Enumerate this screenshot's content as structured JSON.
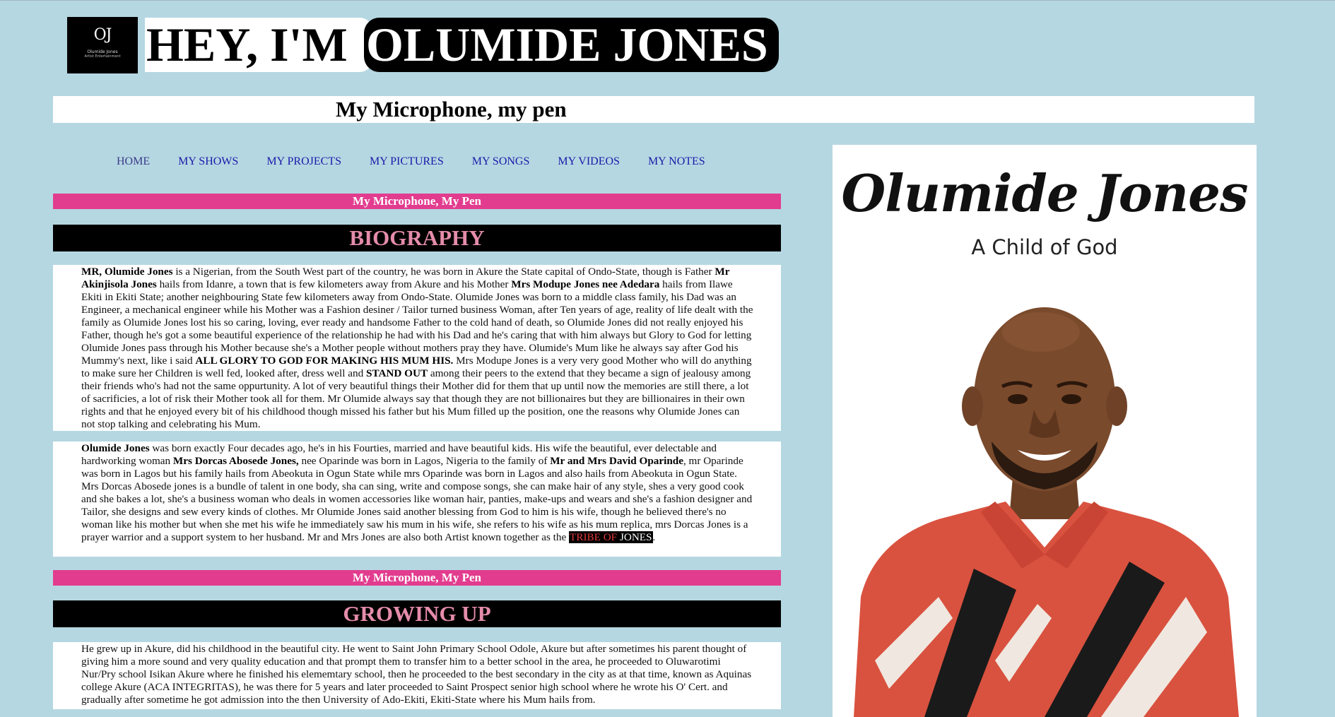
{
  "header": {
    "logo_mono": "OJ",
    "logo_name": "Olumide Jones",
    "logo_role": "Artist Entertainment",
    "hey_text": "HEY, I'M",
    "name_text": "OLUMIDE JONES",
    "tagline": "My Microphone, my pen"
  },
  "nav": {
    "items": [
      "HOME",
      "MY SHOWS",
      "MY PROJECTS",
      "MY PICTURES",
      "MY SONGS",
      "MY VIDEOS",
      "MY NOTES"
    ]
  },
  "sections": {
    "banner_1": "My Microphone, My Pen",
    "biography_title": "BIOGRAPHY",
    "banner_2": "My Microphone, My Pen",
    "growing_title": "GROWING UP"
  },
  "bio_p1": {
    "b1": "MR, Olumide Jones",
    "t1": " is a Nigerian, from the South West part of the country, he was born in Akure the State capital of Ondo-State, though is Father ",
    "b2": "Mr Akinjisola Jones",
    "t2": " hails from Idanre, a town that is few kilometers away from Akure and his Mother ",
    "b3": "Mrs Modupe Jones nee Adedara",
    "t3": " hails from Ilawe Ekiti in Ekiti State; another neighbouring State few kilometers away from Ondo-State. Olumide Jones was born to a middle class family, his Dad was an Engineer, a mechanical engineer while his Mother was a Fashion desiner / Tailor turned business Woman, after Ten years of age, reality of life dealt with the family as Olumide Jones lost his so caring, loving, ever ready and handsome Father to the cold hand of death, so Olumide Jones did not really enjoyed his Father, though he's got a some beautiful experience of the relationship he had with his Dad and he's caring that with him always but Glory to God for letting Olumide Jones pass through his Mother because she's a Mother people without mothers pray they have. Olumide's Mum like he always say after God his Mummy's next, like i said ",
    "b4": "ALL GLORY TO GOD FOR MAKING HIS MUM HIS.",
    "t4": " Mrs Modupe Jones is a very very good Mother who will do anything to make sure her Children is well fed, looked after, dress well and ",
    "b5": "STAND OUT",
    "t5": " among their peers to the extend that they became a sign of jealousy among their friends who's had not the same oppurtunity. A lot of very beautiful things their Mother did for them that up until now the memories are still there, a lot of sacrificies, a lot of risk their Mother took all for them. Mr Olumide always say that though they are not billionaires but they are billionaires in their own rights and that he enjoyed every bit of his childhood though missed his father but his Mum filled up the position, one the reasons why Olumide Jones can not stop talking and celebrating his Mum."
  },
  "bio_p2": {
    "b1": "Olumide Jones",
    "t1": " was born exactly Four decades ago, he's in his Fourties, married and have beautiful kids. His wife the beautiful, ever delectable and hardworking woman ",
    "b2": "Mrs Dorcas Abosede Jones,",
    "t2": " nee Oparinde was born in Lagos, Nigeria to the family of ",
    "b3": "Mr and Mrs David Oparinde",
    "t3": ", mr Oparinde was born in Lagos but his family hails from Abeokuta in Ogun State while mrs Oparinde was born in Lagos and also hails from Abeokuta in Ogun State. Mrs Dorcas Abosede jones is a bundle of talent in one body, sha can sing, write and compose songs, she can make hair of any style, shes a very good cook and she bakes a lot, she's a business woman who deals in women accessories like woman hair, panties, make-ups and wears and she's a fashion designer and Tailor, she designs and sew every kinds of clothes. Mr Olumide Jones said another blessing from God to him is his wife, though he believed there's no woman like his mother but when she met his wife he immediately saw his mum in his wife, she refers to his wife as his mum replica, mrs Dorcas Jones is a prayer warrior and a support system to her husband. Mr and Mrs Jones are also both Artist known together as the ",
    "tribe_red": "TRIBE OF",
    "tribe_white": " JONES",
    "t4": "."
  },
  "growing_p1": "He grew up in Akure, did his childhood in the beautiful city. He went to Saint John Primary School Odole, Akure but after sometimes his parent thought of giving him a more sound and very quality education and that prompt them to transfer him to a better school in the area, he proceeded to Oluwarotimi Nur/Pry school Isikan Akure where he finished his elememtary school, then he proceeded to the best secondary in the city as at that time, known as Aquinas college Akure (ACA INTEGRITAS), he was there for 5 years and later proceeded to Saint Prospect senior high school where he wrote his O' Cert. and gradually after sometime he got admission into the then University of Ado-Ekiti, Ekiti-State where his Mum hails from.",
  "poster": {
    "name": "Olumide Jones",
    "subtitle": "A Child of God"
  },
  "colors": {
    "page_bg": "#b5d7e2",
    "pink_banner": "#e23c8f",
    "section_title_text": "#e58cab",
    "nav_link": "#1a1aa8"
  }
}
